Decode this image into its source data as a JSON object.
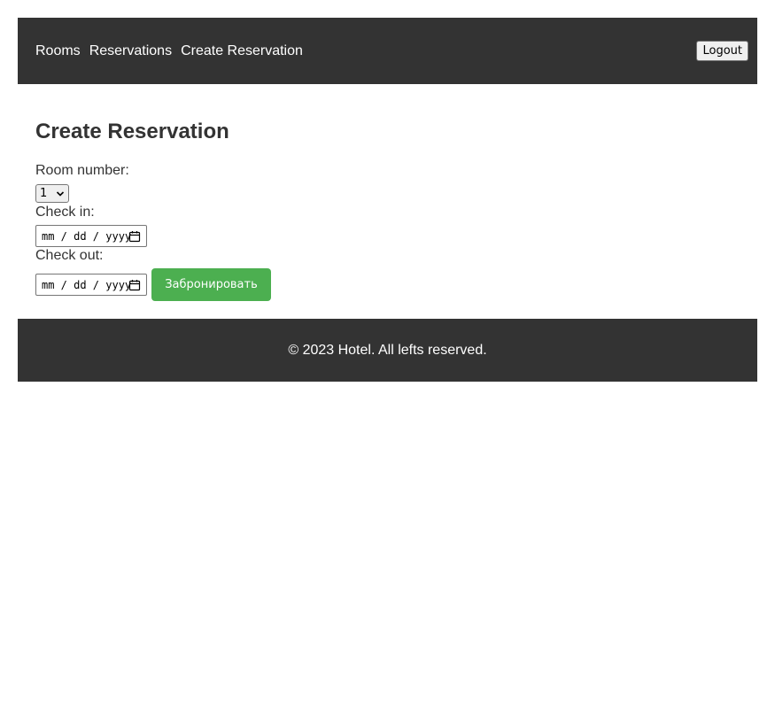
{
  "header": {
    "nav": [
      {
        "label": "Rooms"
      },
      {
        "label": "Reservations"
      },
      {
        "label": "Create Reservation"
      }
    ],
    "logout_label": "Logout"
  },
  "main": {
    "title": "Create Reservation",
    "room_label": "Room number:",
    "room_value": "1",
    "checkin_label": "Check in:",
    "checkin_placeholder": "mm / dd / yyyy",
    "checkout_label": "Check out:",
    "checkout_placeholder": "mm / dd / yyyy",
    "submit_label": "Забронировать"
  },
  "footer": {
    "text": "© 2023 Hotel. All lefts reserved."
  },
  "icons": {
    "select_chevron": "chevron-down-icon",
    "date_picker": "calendar-icon"
  },
  "colors": {
    "header_bg": "#333333",
    "submit_bg": "#4caf50"
  }
}
